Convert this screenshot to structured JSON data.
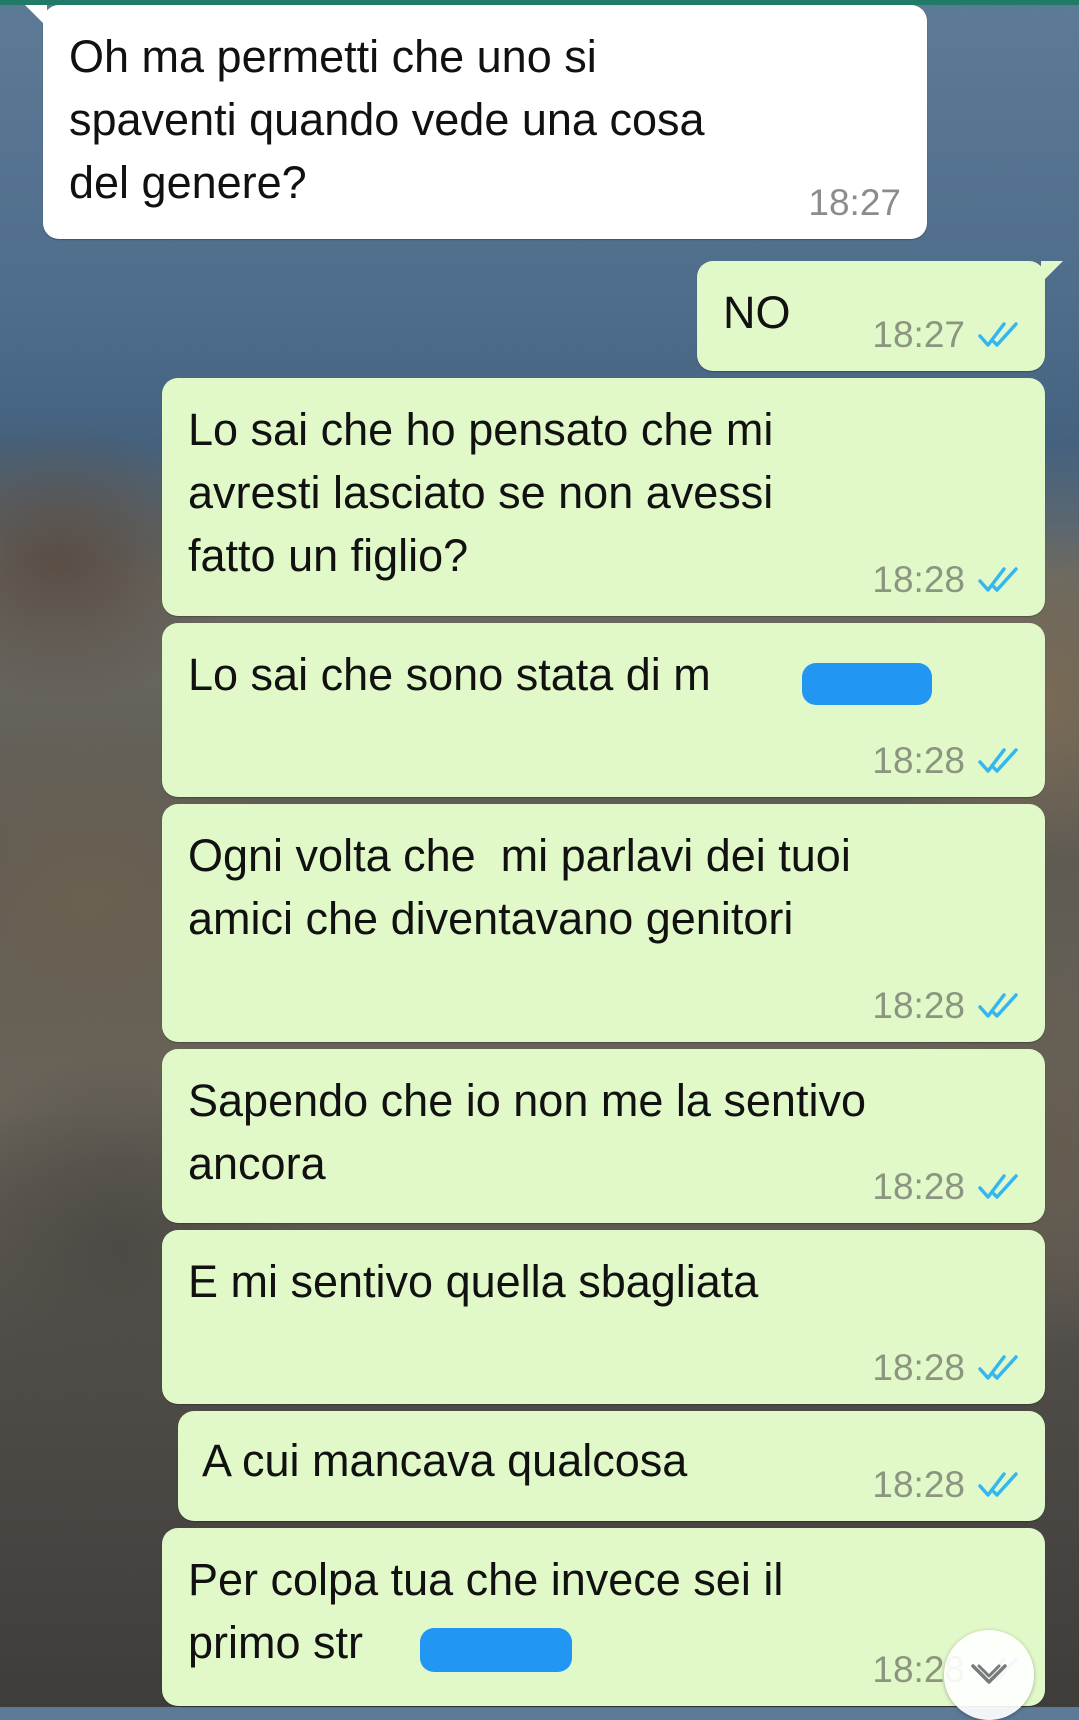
{
  "chat": {
    "messages": [
      {
        "direction": "in",
        "text": "Oh ma permetti che uno si\nspaventi quando vede una cosa\ndel genere?",
        "time": "18:27"
      },
      {
        "direction": "out",
        "text": "NO",
        "time": "18:27",
        "status": "read"
      },
      {
        "direction": "out",
        "text": "Lo sai che ho pensato che mi\navresti lasciato se non avessi\nfatto un figlio?",
        "time": "18:28",
        "status": "read"
      },
      {
        "direction": "out",
        "text": "Lo sai che sono stata di m",
        "time": "18:28",
        "status": "read",
        "redacted": true
      },
      {
        "direction": "out",
        "text": "Ogni volta che  mi parlavi dei tuoi\namici che diventavano genitori",
        "time": "18:28",
        "status": "read"
      },
      {
        "direction": "out",
        "text": "Sapendo che io non me la sentivo\nancora",
        "time": "18:28",
        "status": "read"
      },
      {
        "direction": "out",
        "text": "E mi sentivo quella sbagliata",
        "time": "18:28",
        "status": "read"
      },
      {
        "direction": "out",
        "text": "A cui mancava qualcosa",
        "time": "18:28",
        "status": "read"
      },
      {
        "direction": "out",
        "text": "Per colpa tua che invece sei il\nprimo str",
        "time": "18:28",
        "status": "read",
        "redacted": true
      }
    ]
  },
  "colors": {
    "incoming_bubble": "#ffffff",
    "outgoing_bubble": "#e1f9c9",
    "read_ticks": "#34b7f1",
    "redaction": "#2196f3"
  },
  "icons": {
    "read_receipt": "double-check-icon",
    "scroll_down": "chevron-down-icon"
  }
}
